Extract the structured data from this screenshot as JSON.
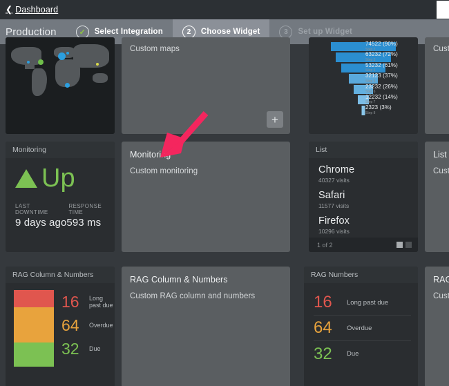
{
  "topbar": {
    "back_label": "Dashboard",
    "back_icon": "chevron-left-icon"
  },
  "wizard": {
    "environment": "Production",
    "steps": [
      {
        "marker": "✓",
        "label": "Select Integration",
        "state": "done"
      },
      {
        "marker": "2",
        "label": "Choose Widget",
        "state": "active"
      },
      {
        "marker": "3",
        "label": "Set up Widget",
        "state": "todo"
      }
    ]
  },
  "options": [
    {
      "title": "",
      "subtitle": "Custom maps",
      "add_icon": "plus-icon",
      "add_label": "+"
    },
    {
      "title": "Monitoring",
      "subtitle": "Custom monitoring"
    },
    {
      "title": "RAG Column & Numbers",
      "subtitle": "Custom RAG column and numbers"
    },
    {
      "title": "Custo",
      "subtitle": ""
    },
    {
      "title": "List",
      "subtitle": "Custo"
    },
    {
      "title": "RAG I",
      "subtitle": "Custo"
    }
  ],
  "widgets": {
    "map": {
      "title": ""
    },
    "funnel": {
      "title": ""
    },
    "monitoring": {
      "title": "Monitoring",
      "status": "Up",
      "status_icon": "triangle-up-icon",
      "meta": [
        {
          "key": "LAST DOWNTIME",
          "value": "9 days ago"
        },
        {
          "key": "RESPONSE TIME",
          "value": "593 ms"
        }
      ]
    },
    "list": {
      "title": "List",
      "items": [
        {
          "name": "Chrome",
          "sub": "40327 visits"
        },
        {
          "name": "Safari",
          "sub": "11577 visits"
        },
        {
          "name": "Firefox",
          "sub": "10296 visits"
        }
      ],
      "pager": "1 of 2"
    },
    "rag_column": {
      "title": "RAG Column & Numbers",
      "rows": [
        {
          "value": "16",
          "label": "Long past due",
          "color": "#e0564e"
        },
        {
          "value": "64",
          "label": "Overdue",
          "color": "#e8a33d"
        },
        {
          "value": "32",
          "label": "Due",
          "color": "#7cc153"
        }
      ]
    },
    "rag_numbers": {
      "title": "RAG Numbers",
      "rows": [
        {
          "value": "16",
          "label": "Long past due",
          "color": "#e0564e"
        },
        {
          "value": "64",
          "label": "Overdue",
          "color": "#e8a33d"
        },
        {
          "value": "32",
          "label": "Due",
          "color": "#7cc153"
        }
      ]
    }
  },
  "chart_data": {
    "type": "bar",
    "subtype": "funnel",
    "title": "",
    "categories": [
      "Step 2",
      "Step 3",
      "Step 4",
      "Step 5",
      "Step 6",
      "Step 7",
      "Step 8"
    ],
    "values": [
      74522,
      63232,
      53232,
      32123,
      23232,
      12232,
      2323
    ],
    "percents": [
      90,
      72,
      61,
      37,
      26,
      14,
      3
    ],
    "labels": [
      "74522 (90%)",
      "63232 (72%)",
      "53232 (61%)",
      "32123 (37%)",
      "23232 (26%)",
      "12232 (14%)",
      "2323 (3%)"
    ],
    "bar_colors": [
      "#2b8ed0",
      "#2b8ed0",
      "#2b8ed0",
      "#5aa9dc",
      "#63b0e0",
      "#7cbde6",
      "#8ac6ea"
    ],
    "grid": false,
    "legend": "none"
  },
  "annotation": {
    "arrow_color": "#f4265e",
    "arrow_icon": "arrow-pointer-icon"
  }
}
